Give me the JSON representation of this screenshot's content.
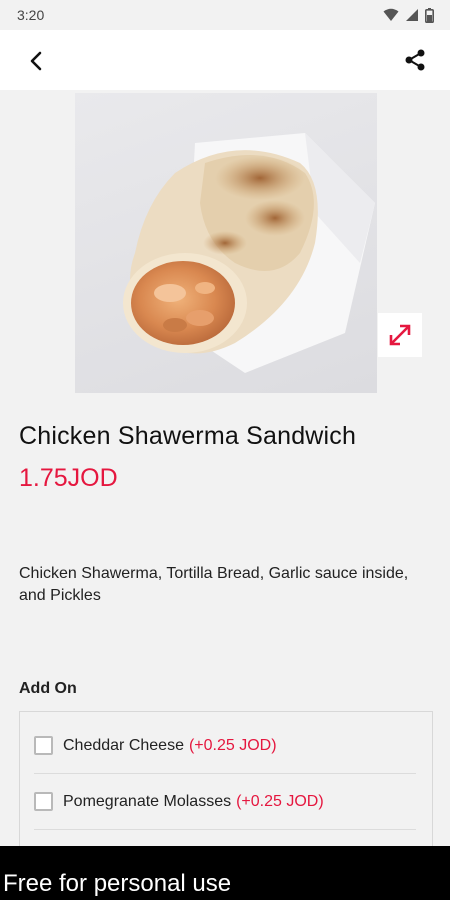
{
  "status_bar": {
    "time": "3:20"
  },
  "app_bar": {
    "back_icon": "arrow-left-icon",
    "share_icon": "share-icon"
  },
  "product": {
    "image_alt": "chicken-shawerma-sandwich-photo",
    "title": "Chicken Shawerma Sandwich",
    "price": "1.75JOD",
    "description": "Chicken Shawerma, Tortilla Bread, Garlic sauce inside, and Pickles"
  },
  "addons": {
    "heading": "Add On",
    "items": [
      {
        "name": "Cheddar Cheese",
        "price": "(+0.25 JOD)",
        "checked": false
      },
      {
        "name": "Pomegranate Molasses",
        "price": "(+0.25 JOD)",
        "checked": false
      }
    ]
  },
  "watermark": "Free for personal use",
  "colors": {
    "accent": "#e5173f",
    "background": "#f2f2f2"
  }
}
